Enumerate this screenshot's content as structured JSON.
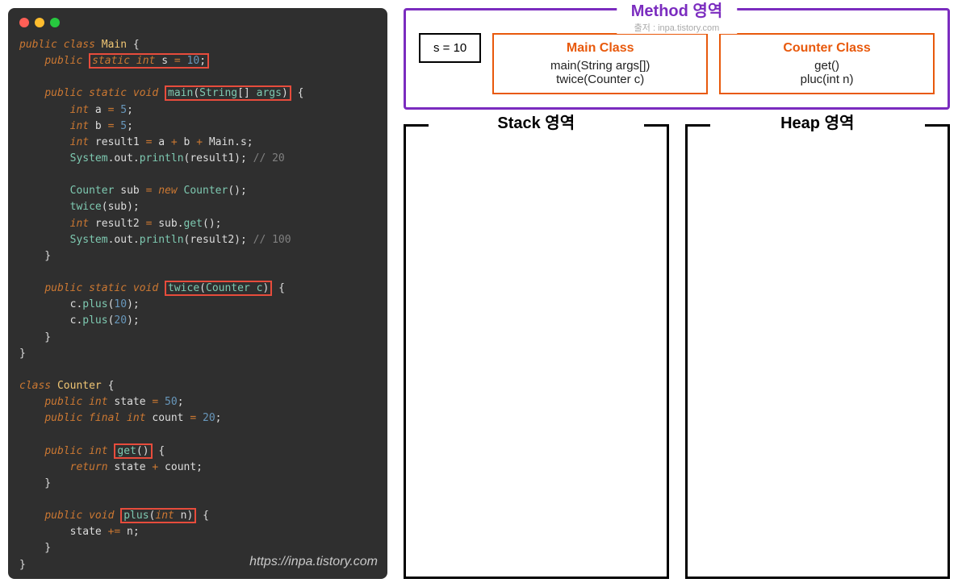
{
  "watermark": "https://inpa.tistory.com",
  "trafficLights": [
    "red",
    "yellow",
    "green"
  ],
  "code": {
    "line1_public": "public",
    "line1_class": "class",
    "line1_Main": "Main",
    "static_field_public": "public",
    "static_field_box": "static int s = 10;",
    "main_sig_pre": "public static void",
    "main_sig_box": "main(String[] args)",
    "a_decl": "int a = 5;",
    "b_decl": "int b = 5;",
    "r1_decl": "int result1 = a + b + Main.s;",
    "print1": "System.out.println(result1);",
    "comment1": "// 20",
    "sub_decl": "Counter sub = new Counter();",
    "twice_call": "twice(sub);",
    "r2_decl": "int result2 = sub.get();",
    "print2": "System.out.println(result2);",
    "comment2": "// 100",
    "twice_sig_pre": "public static void",
    "twice_sig_box": "twice(Counter c)",
    "cplus10": "c.plus(10);",
    "cplus20": "c.plus(20);",
    "counter_class": "class Counter {",
    "state_decl": "public int state = 50;",
    "count_decl": "public final int count = 20;",
    "get_pre": "public int",
    "get_box": "get()",
    "get_body": "return state + count;",
    "plus_pre": "public void",
    "plus_box": "plus(int n)",
    "plus_body": "state += n;"
  },
  "methodArea": {
    "title": "Method 영역",
    "subtitle": "출저 : inpa.tistory.com",
    "staticVar": "s = 10",
    "mainClass": {
      "title": "Main Class",
      "methods": [
        "main(String args[])",
        "twice(Counter c)"
      ]
    },
    "counterClass": {
      "title": "Counter Class",
      "methods": [
        "get()",
        "pluc(int n)"
      ]
    }
  },
  "stackLabel": "Stack 영역",
  "heapLabel": "Heap 영역"
}
